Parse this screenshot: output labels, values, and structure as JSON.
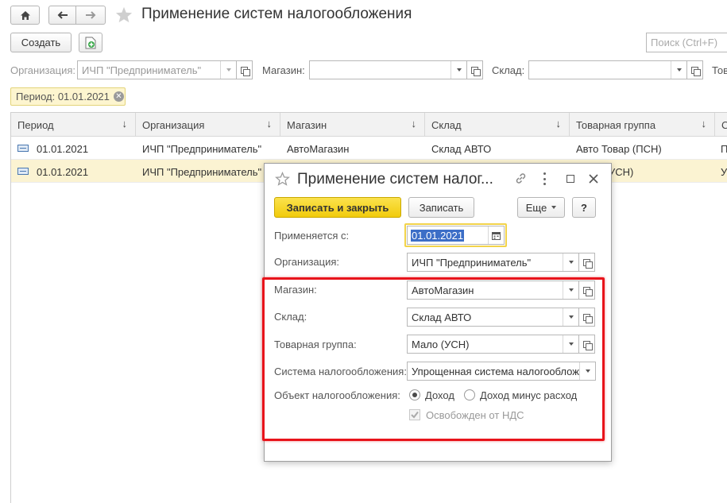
{
  "header": {
    "title": "Применение систем налогообложения",
    "create_label": "Создать",
    "search_placeholder": "Поиск (Ctrl+F)"
  },
  "filters": {
    "org_label": "Организация:",
    "org_value": "ИЧП \"Предприниматель\"",
    "shop_label": "Магазин:",
    "shop_value": "",
    "warehouse_label": "Склад:",
    "warehouse_value": "",
    "more_label": "Тов",
    "period_chip": "Период: 01.01.2021"
  },
  "table": {
    "columns": [
      "Период",
      "Организация",
      "Магазин",
      "Склад",
      "Товарная группа",
      "С"
    ],
    "rows": [
      [
        "01.01.2021",
        "ИЧП \"Предприниматель\"",
        "АвтоМагазин",
        "Склад АВТО",
        "Авто Товар (ПСН)",
        "П"
      ],
      [
        "01.01.2021",
        "ИЧП \"Предприниматель\"",
        "",
        "",
        "УСН)",
        "У"
      ]
    ]
  },
  "dialog": {
    "title": "Применение систем налог...",
    "save_close_label": "Записать и закрыть",
    "save_label": "Записать",
    "more_label": "Еще",
    "help_label": "?",
    "applies_label": "Применяется с:",
    "applies_value": "01.01.2021",
    "org_label": "Организация:",
    "org_value": "ИЧП \"Предприниматель\"",
    "shop_label": "Магазин:",
    "shop_value": "АвтоМагазин",
    "warehouse_label": "Склад:",
    "warehouse_value": "Склад АВТО",
    "group_label": "Товарная группа:",
    "group_value": "Мало (УСН)",
    "tax_label": "Система налогообложения:",
    "tax_value": "Упрощенная система налогооблож",
    "object_label": "Объект налогообложения:",
    "radio_income": "Доход",
    "radio_income_minus": "Доход минус расход",
    "vat_label": "Освобожден от НДС"
  },
  "colors": {
    "accent_yellow": "#f5d418",
    "highlight_red": "#e8141b",
    "selected_row": "#fbf3d2"
  }
}
